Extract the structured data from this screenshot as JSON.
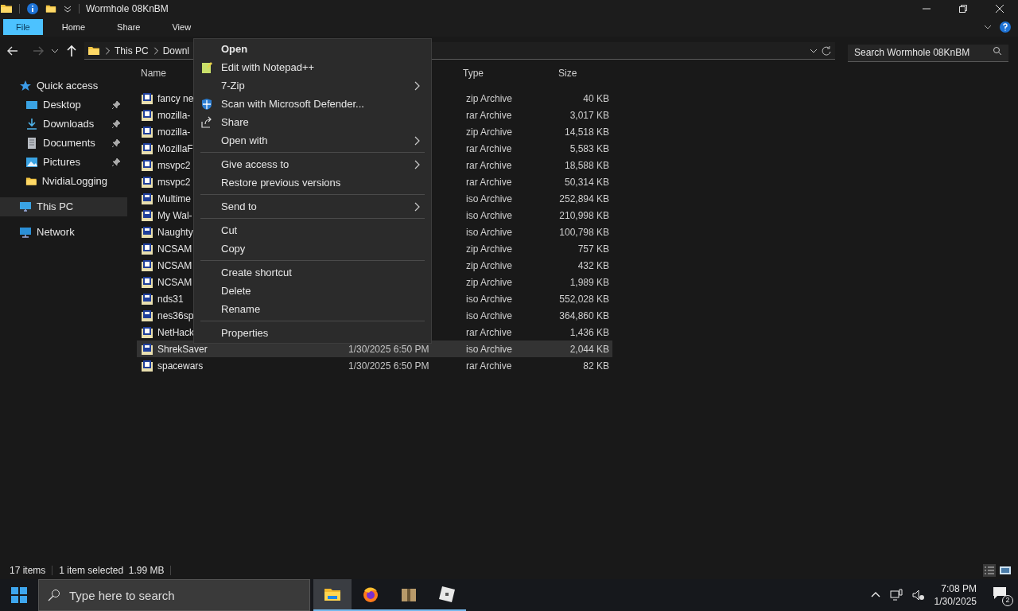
{
  "window": {
    "title": "Wormhole 08KnBM"
  },
  "ribbon_tabs": [
    {
      "label": "File",
      "selected": true
    },
    {
      "label": "Home",
      "selected": false
    },
    {
      "label": "Share",
      "selected": false
    },
    {
      "label": "View",
      "selected": false
    }
  ],
  "address": {
    "crumbs": [
      "This PC",
      "Downl"
    ]
  },
  "search": {
    "placeholder": "Search Wormhole 08KnBM"
  },
  "sidebar": {
    "items": [
      {
        "label": "Quick access",
        "kind": "star",
        "selected": false,
        "children": [
          {
            "label": "Desktop",
            "kind": "desktop",
            "pinned": true,
            "selected": false
          },
          {
            "label": "Downloads",
            "kind": "download",
            "pinned": true,
            "selected": false
          },
          {
            "label": "Documents",
            "kind": "document",
            "pinned": true,
            "selected": false
          },
          {
            "label": "Pictures",
            "kind": "pictures",
            "pinned": true,
            "selected": false
          },
          {
            "label": "NvidiaLogging",
            "kind": "folder",
            "pinned": false,
            "selected": false
          }
        ]
      },
      {
        "label": "This PC",
        "kind": "pc",
        "selected": true
      },
      {
        "label": "Network",
        "kind": "network",
        "selected": false
      }
    ]
  },
  "table": {
    "columns": [
      "Name",
      "Type",
      "Size"
    ],
    "rows": [
      {
        "kind": "zip",
        "name": "fancy ne",
        "type": "zip Archive",
        "size": "40 KB",
        "selected": false
      },
      {
        "kind": "rar",
        "name": "mozilla-",
        "type": "rar Archive",
        "size": "3,017 KB",
        "selected": false
      },
      {
        "kind": "zip",
        "name": "mozilla-",
        "type": "zip Archive",
        "size": "14,518 KB",
        "selected": false
      },
      {
        "kind": "rar",
        "name": "MozillaF",
        "type": "rar Archive",
        "size": "5,583 KB",
        "selected": false
      },
      {
        "kind": "rar",
        "name": "msvpc2",
        "type": "rar Archive",
        "size": "18,588 KB",
        "selected": false
      },
      {
        "kind": "rar",
        "name": "msvpc2",
        "type": "rar Archive",
        "size": "50,314 KB",
        "selected": false
      },
      {
        "kind": "iso",
        "name": "Multime",
        "type": "iso Archive",
        "size": "252,894 KB",
        "selected": false
      },
      {
        "kind": "iso",
        "name": "My Wal-",
        "type": "iso Archive",
        "size": "210,998 KB",
        "selected": false
      },
      {
        "kind": "iso",
        "name": "Naughty",
        "type": "iso Archive",
        "size": "100,798 KB",
        "selected": false
      },
      {
        "kind": "zip",
        "name": "NCSAM",
        "type": "zip Archive",
        "size": "757 KB",
        "selected": false
      },
      {
        "kind": "zip",
        "name": "NCSAM",
        "type": "zip Archive",
        "size": "432 KB",
        "selected": false
      },
      {
        "kind": "zip",
        "name": "NCSAM",
        "type": "zip Archive",
        "size": "1,989 KB",
        "selected": false
      },
      {
        "kind": "iso",
        "name": "nds31",
        "type": "iso Archive",
        "size": "552,028 KB",
        "selected": false
      },
      {
        "kind": "iso",
        "name": "nes36sp",
        "type": "iso Archive",
        "size": "364,860 KB",
        "selected": false
      },
      {
        "kind": "rar",
        "name": "NetHack",
        "type": "rar Archive",
        "size": "1,436 KB",
        "selected": false
      },
      {
        "kind": "iso",
        "name": "ShrekSaver",
        "date": "1/30/2025 6:50 PM",
        "type": "iso Archive",
        "size": "2,044 KB",
        "selected": true
      },
      {
        "kind": "rar",
        "name": "spacewars",
        "date": "1/30/2025 6:50 PM",
        "type": "rar Archive",
        "size": "82 KB",
        "selected": false
      }
    ]
  },
  "context_menu": {
    "groups": [
      [
        {
          "label": "Open",
          "default": true,
          "submenu": false
        },
        {
          "label": "Edit with Notepad++",
          "kind": "notepad",
          "default": false,
          "submenu": false
        },
        {
          "label": "7-Zip",
          "default": false,
          "submenu": true
        },
        {
          "label": "Scan with Microsoft Defender...",
          "kind": "shield",
          "default": false,
          "submenu": false
        },
        {
          "label": "Share",
          "kind": "share",
          "default": false,
          "submenu": false
        },
        {
          "label": "Open with",
          "default": false,
          "submenu": true
        }
      ],
      [
        {
          "label": "Give access to",
          "default": false,
          "submenu": true
        },
        {
          "label": "Restore previous versions",
          "default": false,
          "submenu": false
        }
      ],
      [
        {
          "label": "Send to",
          "default": false,
          "submenu": true
        }
      ],
      [
        {
          "label": "Cut",
          "default": false,
          "submenu": false
        },
        {
          "label": "Copy",
          "default": false,
          "submenu": false
        }
      ],
      [
        {
          "label": "Create shortcut",
          "default": false,
          "submenu": false
        },
        {
          "label": "Delete",
          "default": false,
          "submenu": false
        },
        {
          "label": "Rename",
          "default": false,
          "submenu": false
        }
      ],
      [
        {
          "label": "Properties",
          "default": false,
          "submenu": false
        }
      ]
    ]
  },
  "status_bar": {
    "items": [
      "17 items",
      "1 item selected  1.99 MB"
    ]
  },
  "taskbar": {
    "search_placeholder": "Type here to search",
    "apps": [
      {
        "kind": "explorer",
        "selected": true
      },
      {
        "kind": "firefox",
        "selected": false
      },
      {
        "kind": "archive",
        "selected": false
      },
      {
        "kind": "cube",
        "selected": false
      }
    ],
    "time": "7:08 PM",
    "date": "1/30/2025",
    "notifications": "2"
  }
}
